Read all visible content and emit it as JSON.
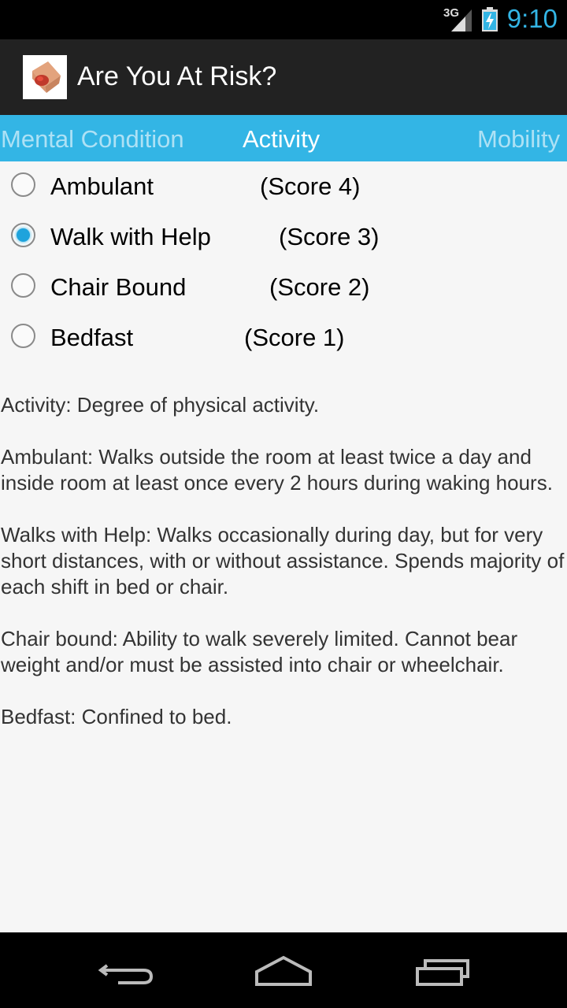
{
  "status_bar": {
    "network": "3G",
    "time": "9:10",
    "icons": [
      "signal-icon",
      "battery-charging-icon"
    ],
    "accent_color": "#33b5e5"
  },
  "app": {
    "title": "Are You At Risk?",
    "icon": "app-logo-icon"
  },
  "tabs": [
    {
      "label": "Mental Condition"
    },
    {
      "label": "Activity"
    },
    {
      "label": "Mobility"
    }
  ],
  "active_tab": "Activity",
  "options": [
    {
      "label": "Ambulant",
      "score": "(Score 4)",
      "selected": false
    },
    {
      "label": "Walk with Help",
      "score": "(Score 3)",
      "selected": true
    },
    {
      "label": "Chair Bound",
      "score": "(Score 2)",
      "selected": false
    },
    {
      "label": "Bedfast",
      "score": "(Score 1)",
      "selected": false
    }
  ],
  "description": [
    "Activity: Degree of physical activity.",
    "Ambulant: Walks outside the room at least twice a day and inside room at least once every 2 hours during waking hours.",
    "Walks with Help: Walks occasionally during day, but for very short distances, with or without assistance. Spends majority of each shift in bed or chair.",
    "Chair bound: Ability to walk severely limited. Cannot bear weight and/or must be assisted into chair or wheelchair.",
    "Bedfast: Confined to bed."
  ],
  "nav_bar": {
    "buttons": [
      "back-icon",
      "home-icon",
      "recent-apps-icon"
    ]
  }
}
